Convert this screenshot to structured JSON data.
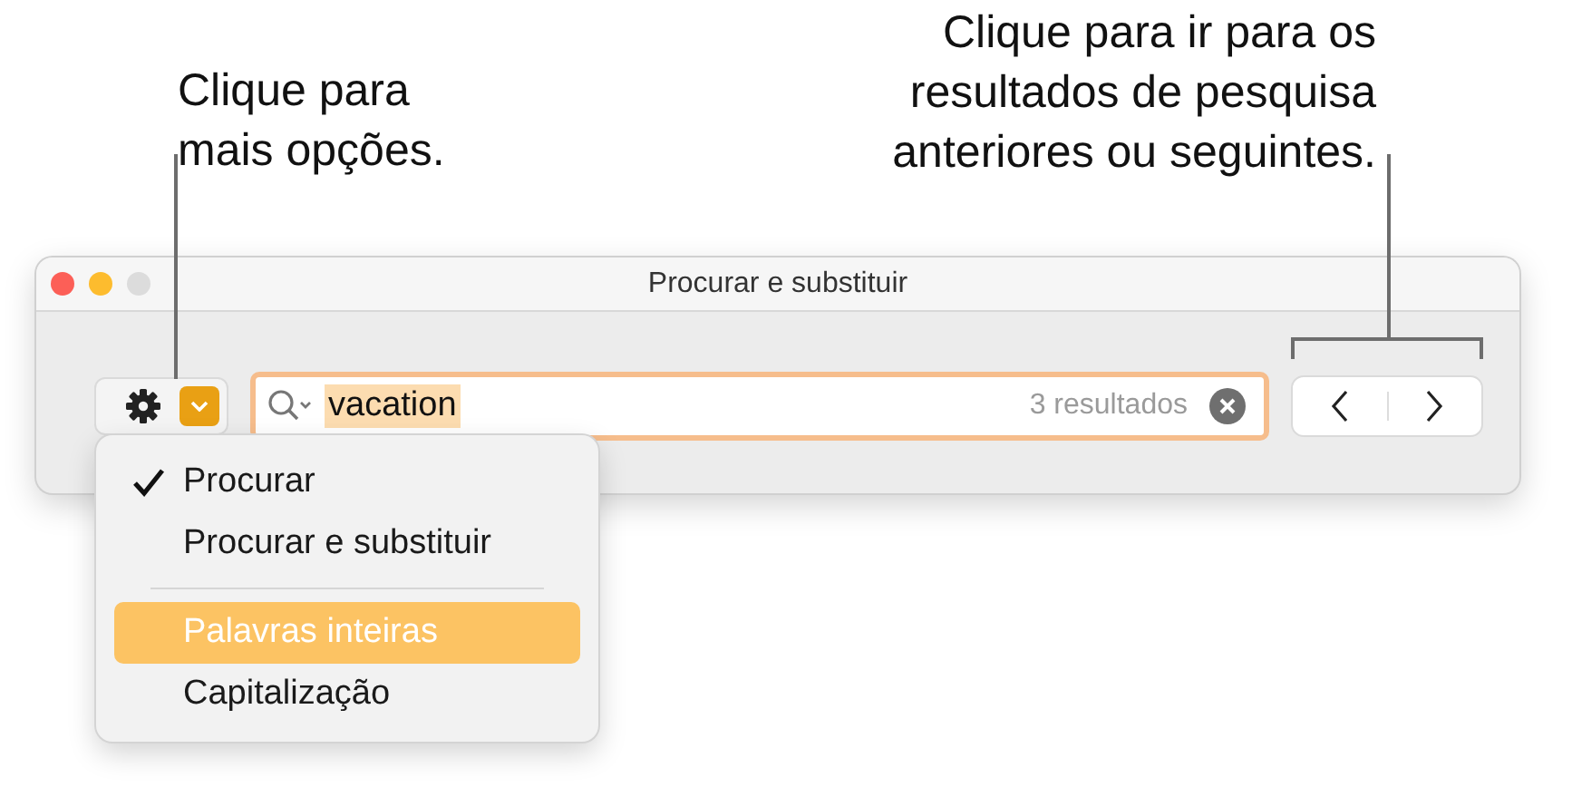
{
  "callout_left": {
    "text": "Clique para\nmais opções."
  },
  "callout_right": {
    "text": "Clique para ir para os\nresultados de pesquisa\nanteriores ou seguintes."
  },
  "window": {
    "title": "Procurar e substituir"
  },
  "search": {
    "value": "vacation",
    "highlighted": true,
    "result_count": "3 resultados"
  },
  "menu": {
    "open": true,
    "items": [
      {
        "kind": "item",
        "label": "Procurar",
        "checked": true,
        "selected": false
      },
      {
        "kind": "item",
        "label": "Procurar e substituir",
        "checked": false,
        "selected": false
      },
      {
        "kind": "separator"
      },
      {
        "kind": "item",
        "label": "Palavras inteiras",
        "checked": false,
        "selected": true
      },
      {
        "kind": "item",
        "label": "Capitalização",
        "checked": false,
        "selected": false
      }
    ]
  }
}
